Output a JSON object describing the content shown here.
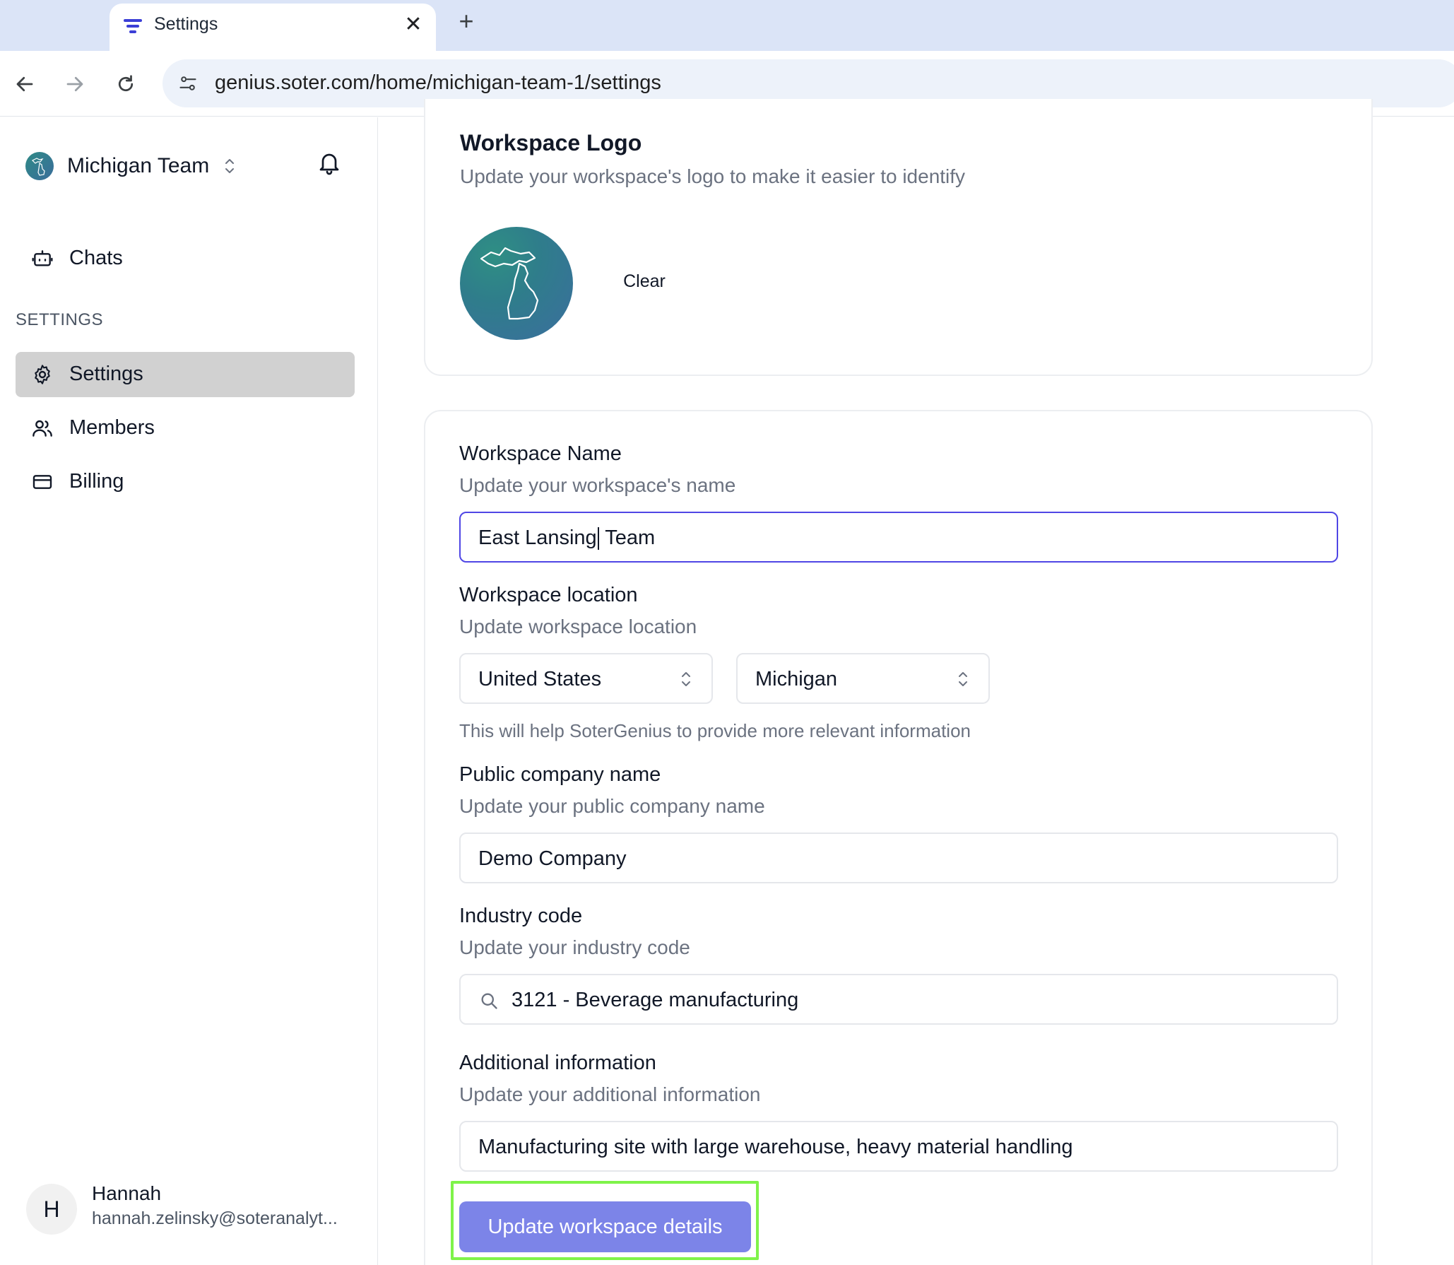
{
  "browser": {
    "tab_title": "Settings",
    "url": "genius.soter.com/home/michigan-team-1/settings"
  },
  "sidebar": {
    "workspace_name": "Michigan Team",
    "items": [
      {
        "label": "Chats",
        "icon": "bot-icon"
      },
      {
        "label": "Settings",
        "icon": "gear-icon"
      },
      {
        "label": "Members",
        "icon": "users-icon"
      },
      {
        "label": "Billing",
        "icon": "credit-card-icon"
      }
    ],
    "section_label": "SETTINGS",
    "user": {
      "initial": "H",
      "name": "Hannah",
      "email": "hannah.zelinsky@soteranalyt..."
    }
  },
  "logo_card": {
    "title": "Workspace Logo",
    "subtitle": "Update your workspace's logo to make it easier to identify",
    "clear_label": "Clear"
  },
  "form": {
    "name": {
      "title": "Workspace Name",
      "subtitle": "Update your workspace's name",
      "value_before_caret": "East Lansing",
      "value_after_caret": " Team"
    },
    "location": {
      "title": "Workspace location",
      "subtitle": "Update workspace location",
      "country": "United States",
      "state": "Michigan",
      "note": "This will help SoterGenius to provide more relevant information"
    },
    "company": {
      "title": "Public company name",
      "subtitle": "Update your public company name",
      "value": "Demo Company"
    },
    "industry": {
      "title": "Industry code",
      "subtitle": "Update your industry code",
      "value": "3121 - Beverage manufacturing"
    },
    "additional": {
      "title": "Additional information",
      "subtitle": "Update your additional information",
      "value": "Manufacturing site with large warehouse, heavy material handling"
    },
    "submit_label": "Update workspace details"
  },
  "colors": {
    "accent": "#4f46e5",
    "button": "#7c84e8",
    "highlight": "#7ff34a",
    "active_nav": "#d1d1d1"
  }
}
